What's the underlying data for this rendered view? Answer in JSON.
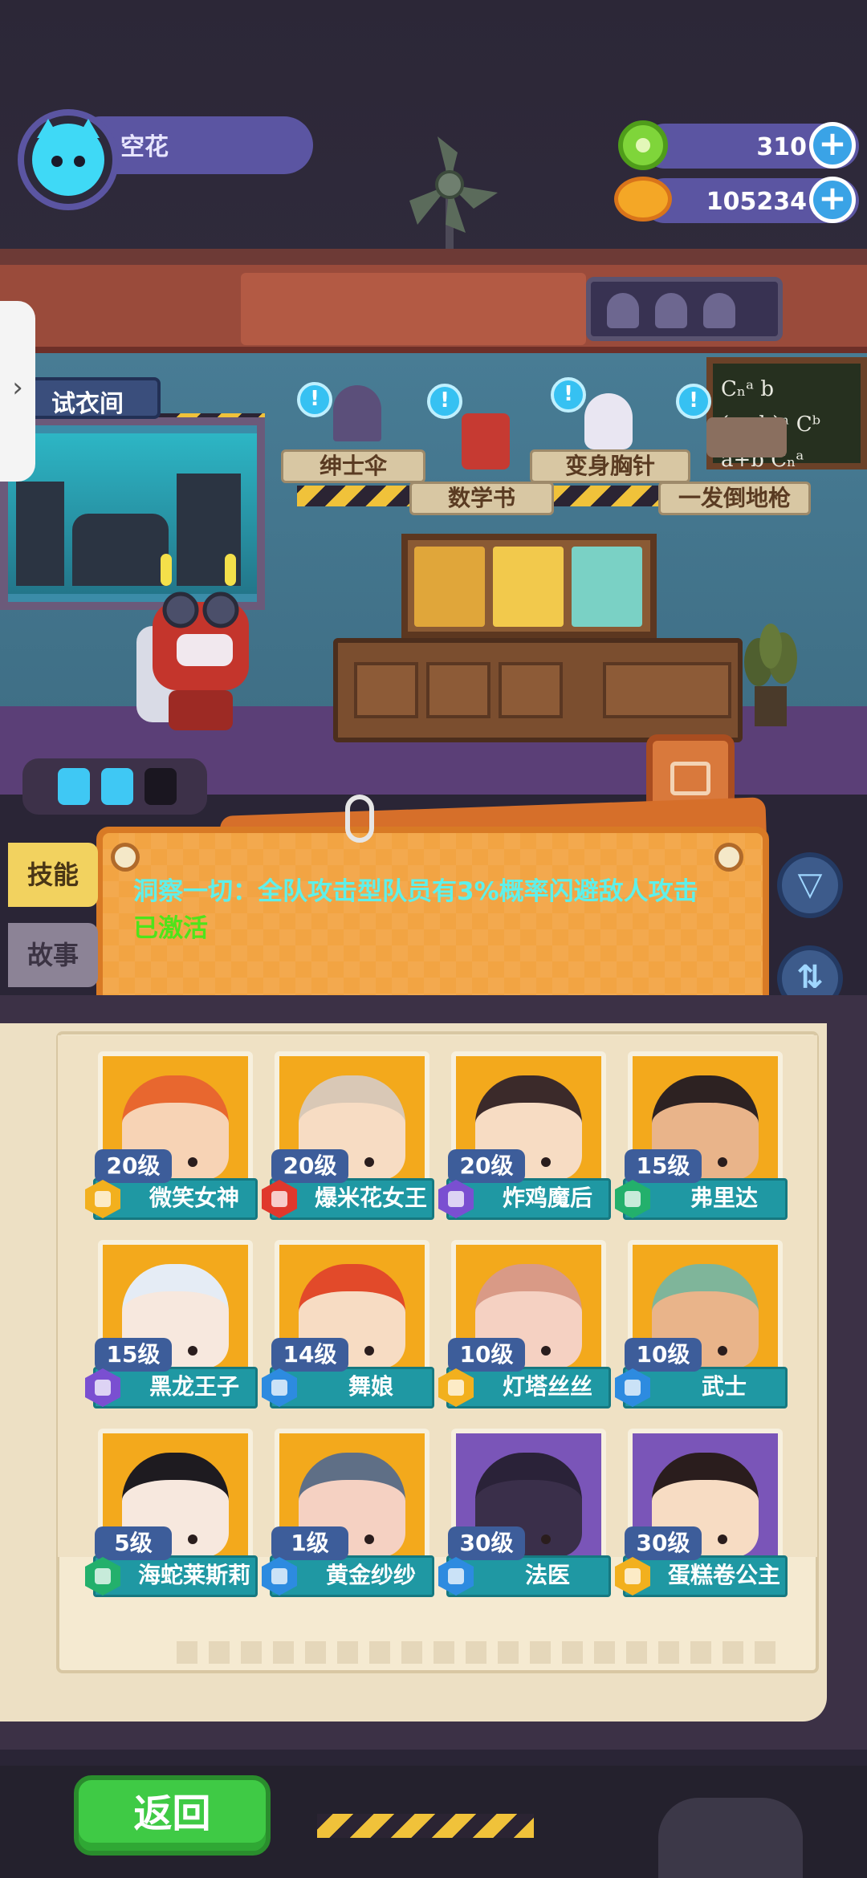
{
  "player": {
    "name": "空花"
  },
  "currency": {
    "gems": "310",
    "coins": "105234",
    "add_symbol": "+"
  },
  "room": {
    "label": "试衣间",
    "side_tab_symbol": "›"
  },
  "shelf": {
    "items": [
      {
        "label": "绅士伞",
        "info": "!"
      },
      {
        "label": "数学书",
        "info": "!"
      },
      {
        "label": "变身胸针",
        "info": "!"
      },
      {
        "label": "一发倒地枪",
        "info": "!"
      }
    ]
  },
  "chalkboard": {
    "line1": "Cₙᵃ b",
    "line2": "(a+b)ⁿ Cᵇ",
    "line3": "a+b   Cₙᵃ"
  },
  "tabs": {
    "skill": "技能",
    "story": "故事"
  },
  "skill": {
    "text": "洞察一切：全队攻击型队员有3%概率闪避敌人攻击",
    "status": "已激活"
  },
  "buttons": {
    "filter_icon": "▽",
    "sort_icon": "⇅",
    "back": "返回"
  },
  "roster": [
    {
      "name": "微笑女神",
      "level": "20级",
      "role_color": "#f2b01e",
      "bg": "#f3a91c",
      "face": "#f7d3b5",
      "hair": "#e8672f"
    },
    {
      "name": "爆米花女王",
      "level": "20级",
      "role_color": "#e0382c",
      "bg": "#f3a91c",
      "face": "#f7dcc3",
      "hair": "#d9c8b6"
    },
    {
      "name": "炸鸡魔后",
      "level": "20级",
      "role_color": "#7a4fd1",
      "bg": "#f3a91c",
      "face": "#f7dcc3",
      "hair": "#3b2a2a"
    },
    {
      "name": "弗里达",
      "level": "15级",
      "role_color": "#23b06c",
      "bg": "#f3a91c",
      "face": "#e9b48a",
      "hair": "#2d2222"
    },
    {
      "name": "黑龙王子",
      "level": "15级",
      "role_color": "#7a4fd1",
      "bg": "#f3a91c",
      "face": "#f7e8de",
      "hair": "#e5ecf5"
    },
    {
      "name": "舞娘",
      "level": "14级",
      "role_color": "#2d8be0",
      "bg": "#f3a91c",
      "face": "#f7dcc3",
      "hair": "#e24a2a"
    },
    {
      "name": "灯塔丝丝",
      "level": "10级",
      "role_color": "#f2b01e",
      "bg": "#f3a91c",
      "face": "#f5d1c2",
      "hair": "#d99a86"
    },
    {
      "name": "武士",
      "level": "10级",
      "role_color": "#2d8be0",
      "bg": "#f3a91c",
      "face": "#e9b48a",
      "hair": "#7fb59a"
    },
    {
      "name": "海蛇莱斯莉",
      "level": "5级",
      "role_color": "#23b06c",
      "bg": "#f3a91c",
      "face": "#f7e8de",
      "hair": "#1e1b20"
    },
    {
      "name": "黄金纱纱",
      "level": "1级",
      "role_color": "#2d8be0",
      "bg": "#f3a91c",
      "face": "#f5d1c2",
      "hair": "#5f6f86"
    },
    {
      "name": "法医",
      "level": "30级",
      "role_color": "#2d8be0",
      "bg": "#7a55b8",
      "face": "#3a2f4a",
      "hair": "#2a2238"
    },
    {
      "name": "蛋糕卷公主",
      "level": "30级",
      "role_color": "#f2b01e",
      "bg": "#7a55b8",
      "face": "#f7dcc3",
      "hair": "#2a1d1d"
    }
  ]
}
